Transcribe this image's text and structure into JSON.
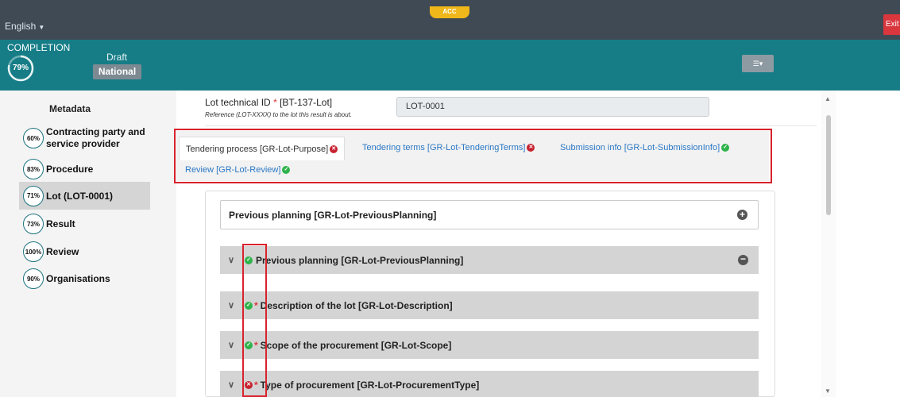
{
  "topbar": {
    "language": "English",
    "env_badge": "ACC",
    "exit_label": "Exit"
  },
  "completion": {
    "title": "COMPLETION",
    "percent": "79%",
    "status": "Draft",
    "scope": "National"
  },
  "sidebar": {
    "metadata": "Metadata",
    "items": [
      {
        "pct": "60%",
        "label": "Contracting party and service provider"
      },
      {
        "pct": "83%",
        "label": "Procedure"
      },
      {
        "pct": "71%",
        "label": "Lot (LOT-0001)"
      },
      {
        "pct": "73%",
        "label": "Result"
      },
      {
        "pct": "100%",
        "label": "Review"
      },
      {
        "pct": "90%",
        "label": "Organisations"
      }
    ]
  },
  "field": {
    "label": "Lot technical ID",
    "required_mark": "*",
    "code": "[BT-137-Lot]",
    "help": "Reference (LOT-XXXX) to the lot this result is about.",
    "value": "LOT-0001"
  },
  "tabs": [
    {
      "label": "Tendering process  [GR-Lot-Purpose]",
      "status": "error"
    },
    {
      "label": "Tendering terms  [GR-Lot-TenderingTerms]",
      "status": "error"
    },
    {
      "label": "Submission info  [GR-Lot-SubmissionInfo]",
      "status": "ok"
    },
    {
      "label": "Review  [GR-Lot-Review]",
      "status": "ok"
    }
  ],
  "card": {
    "title": "Previous planning  [GR-Lot-PreviousPlanning]"
  },
  "accordion": [
    {
      "label": "Previous planning  [GR-Lot-PreviousPlanning]",
      "status": "ok",
      "required": false
    },
    {
      "label": "Description of the lot  [GR-Lot-Description]",
      "status": "ok",
      "required": true
    },
    {
      "label": "Scope of the procurement  [GR-Lot-Scope]",
      "status": "ok",
      "required": true
    },
    {
      "label": "Type of procurement  [GR-Lot-ProcurementType]",
      "status": "error",
      "required": true
    }
  ],
  "colors": {
    "topbar": "#3f4a55",
    "band": "#167d87",
    "ok": "#2fb34b",
    "error": "#c72231",
    "highlight": "#d9232e"
  }
}
